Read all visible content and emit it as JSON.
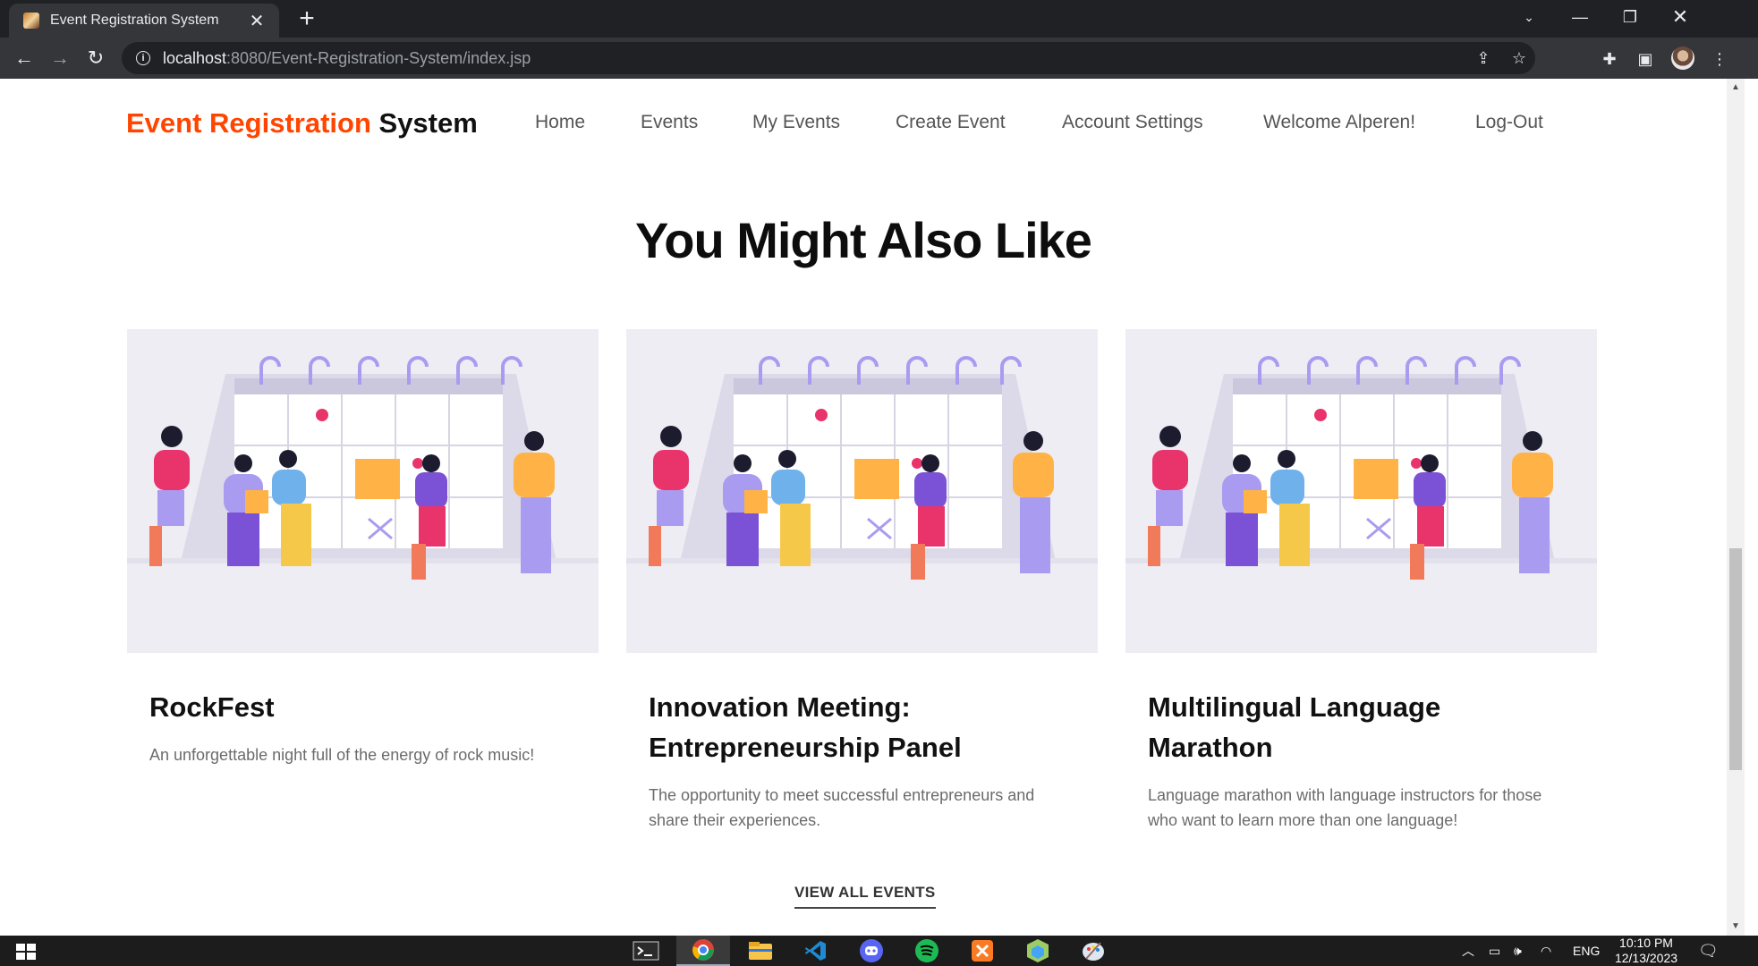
{
  "browser": {
    "tab_title": "Event Registration System",
    "url_host": "localhost",
    "url_rest": ":8080/Event-Registration-System/index.jsp"
  },
  "site": {
    "brand_accent": "Event Registration",
    "brand_rest": "System",
    "nav": [
      "Home",
      "Events",
      "My Events",
      "Create Event",
      "Account Settings",
      "Welcome Alperen!",
      "Log-Out"
    ]
  },
  "section": {
    "title": "You Might Also Like",
    "cards": [
      {
        "title": "RockFest",
        "description": "An unforgettable night full of the energy of rock music!"
      },
      {
        "title": "Innovation Meeting: Entrepreneurship Panel",
        "description": "The opportunity to meet successful entrepreneurs and share their experiences."
      },
      {
        "title": "Multilingual Language Marathon",
        "description": "Language marathon with language instructors for those who want to learn more than one language!"
      }
    ],
    "view_all": "VIEW ALL EVENTS"
  },
  "taskbar": {
    "language": "ENG",
    "time": "10:10 PM",
    "date": "12/13/2023",
    "apps": [
      "terminal-icon",
      "chrome-icon",
      "file-explorer-icon",
      "vscode-icon",
      "discord-icon",
      "spotify-icon",
      "xampp-icon",
      "app-cube-icon",
      "paint-icon"
    ]
  },
  "colors": {
    "brand_accent": "#ff4500",
    "card_image_bg": "#eeedf4",
    "illustration_purple": "#a99cf0",
    "illustration_yellow": "#ffb347",
    "illustration_pink": "#e8336b"
  }
}
